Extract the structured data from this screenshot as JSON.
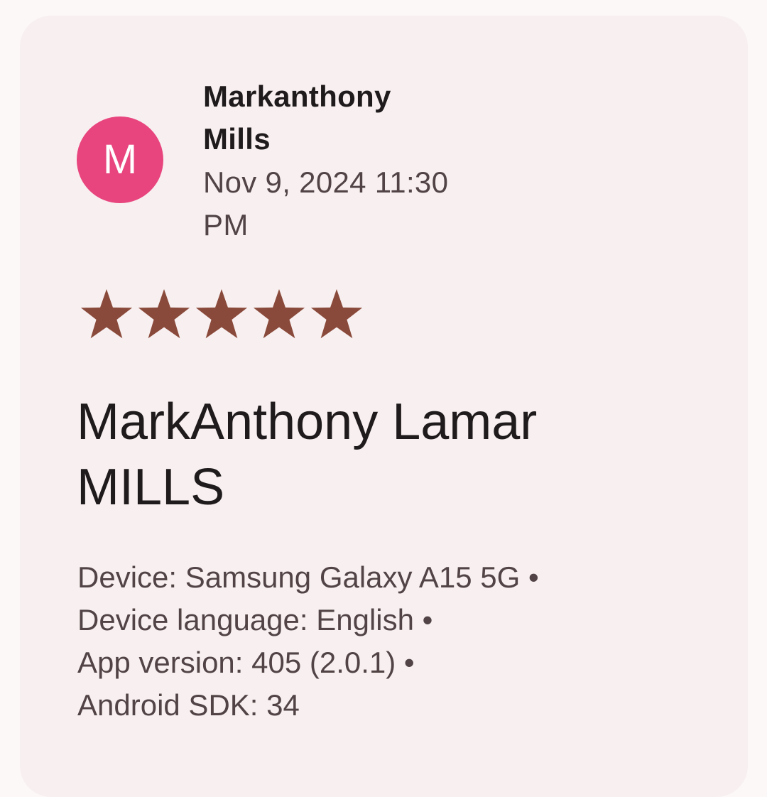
{
  "review": {
    "avatar_initial": "M",
    "avatar_color": "#e8457e",
    "author_line1": "Markanthony",
    "author_line2": "Mills",
    "date_line1": "Nov 9, 2024 11:30",
    "date_line2": "PM",
    "rating": 5,
    "rating_max": 5,
    "star_icon": "star-icon",
    "star_color": "#8a4a3b",
    "title_line1": "MarkAnthony Lamar",
    "title_line2": "MILLS",
    "device_info": [
      "Device: Samsung Galaxy A15 5G •",
      "Device language: English •",
      "App version: 405 (2.0.1) •",
      "Android SDK: 34"
    ]
  },
  "colors": {
    "page_background": "#fdf8f8",
    "card_background": "#f8f0f0",
    "primary_text": "#1f1a1b",
    "secondary_text": "#524446"
  }
}
